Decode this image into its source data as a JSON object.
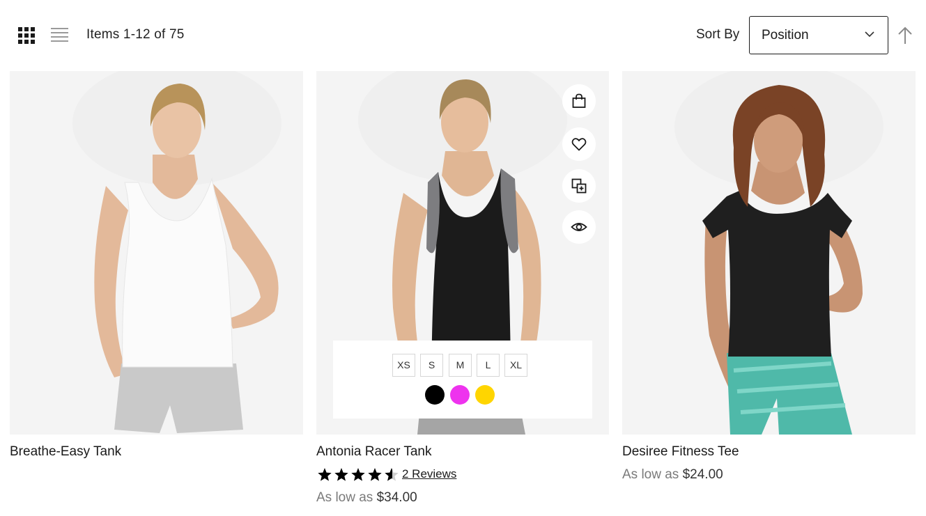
{
  "toolbar": {
    "amount_text": "Items 1-12 of 75",
    "sort_label": "Sort By",
    "sort_value": "Position"
  },
  "products": [
    {
      "name": "Breathe-Easy Tank"
    },
    {
      "name": "Antonia Racer Tank",
      "rating_fraction": 0.9,
      "reviews_text": "2  Reviews",
      "price_prefix": "As low as",
      "price": "$34.00",
      "sizes": [
        "XS",
        "S",
        "M",
        "L",
        "XL"
      ],
      "colors": [
        "#000000",
        "#ee33ee",
        "#ffd500"
      ]
    },
    {
      "name": "Desiree Fitness Tee",
      "price_prefix": "As low as",
      "price": "$24.00"
    }
  ],
  "icons": {
    "grid_mode": "grid-icon",
    "list_mode": "list-icon",
    "sort_direction": "arrow-up-icon",
    "add_to_cart": "shopping-bag-icon",
    "wishlist": "heart-icon",
    "compare": "compare-icon",
    "quick_view": "eye-icon"
  }
}
